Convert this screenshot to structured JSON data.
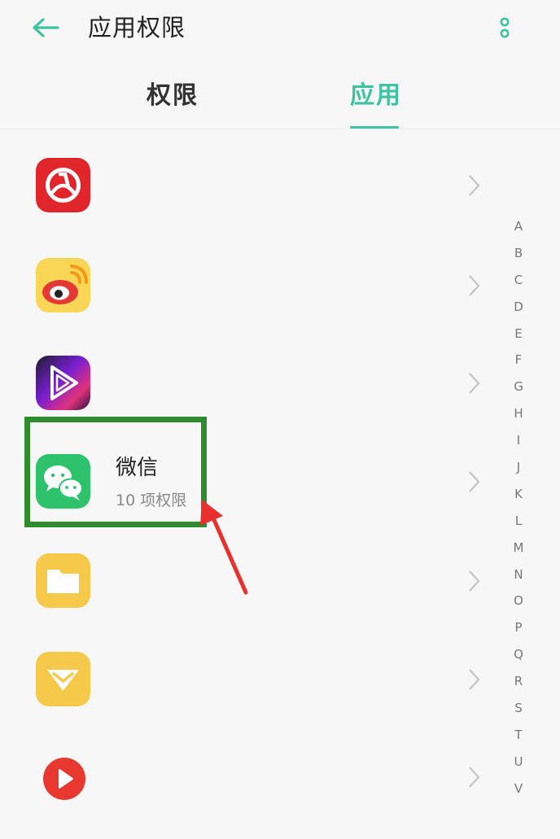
{
  "header": {
    "title": "应用权限"
  },
  "tabs": [
    {
      "label": "权限",
      "active": false
    },
    {
      "label": "应用",
      "active": true
    }
  ],
  "apps": [
    {
      "icon": "red-app-icon",
      "name": "",
      "sub": ""
    },
    {
      "icon": "weibo-icon",
      "name": "",
      "sub": ""
    },
    {
      "icon": "video-play-app-icon",
      "name": "",
      "sub": ""
    },
    {
      "icon": "wechat-icon",
      "name": "微信",
      "sub": "10 项权限"
    },
    {
      "icon": "file-manager-icon",
      "name": "",
      "sub": ""
    },
    {
      "icon": "yellow-diamond-app-icon",
      "name": "",
      "sub": ""
    },
    {
      "icon": "red-play-app-icon",
      "name": "",
      "sub": ""
    }
  ],
  "alphabet": [
    "A",
    "B",
    "C",
    "D",
    "E",
    "F",
    "G",
    "H",
    "I",
    "J",
    "K",
    "L",
    "M",
    "N",
    "O",
    "P",
    "Q",
    "R",
    "S",
    "T",
    "U",
    "V"
  ],
  "colors": {
    "accent": "#3fc2a0",
    "annotation_box": "#2e8b2e",
    "annotation_arrow": "#e8312f"
  }
}
